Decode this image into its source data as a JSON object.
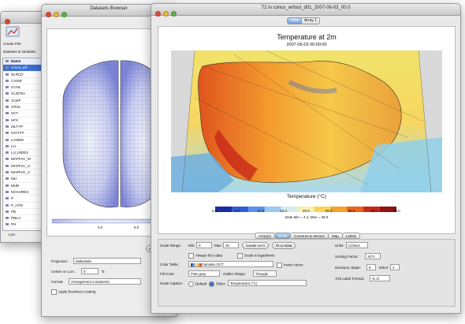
{
  "window_datasets": {
    "title": "",
    "toolbar_label": "Create Plot",
    "section_label": "Datasets & Variables",
    "column_name": "Name",
    "root_item": "conus_wrf",
    "items": [
      "NLRCD",
      "CANW",
      "CCNL",
      "CLDFRA",
      "CLWF",
      "CRGL",
      "HCT",
      "HFX",
      "ISLTYP",
      "IVGTYP",
      "LANDM",
      "LH",
      "LU_INDEX",
      "MAPFAC_M",
      "MAPFAC_U",
      "MAPFAC_V",
      "MU",
      "MUB",
      "NOAHRES",
      "P",
      "P_HYD",
      "PB",
      "PBLH",
      "PH"
    ],
    "lon_label": "Lon:"
  },
  "window_browser": {
    "title": "Datasets Browser",
    "colorbar_min": "0.0",
    "colorbar_max": "5.0",
    "projection_label": "Projection:",
    "projection_value": "Mollweide",
    "center_lon_label": "Center on Lon.:",
    "center_lon_value": "0",
    "center_lon_unit": "°E",
    "format_label": "Format:",
    "format_value": "Arrangement Continents",
    "bromley_label": "Apply Bromley's scaling",
    "arrays_btn": "Arrays"
  },
  "window_plot": {
    "title": "T2 in conus_wrfout_d01_2007-06-03_00.0",
    "top_tabs": [
      "Plot",
      "Array 1"
    ],
    "plot_title": "Temperature at 2m",
    "plot_subtitle": "2007-06-03 00:00:00",
    "colorbar_label": "Temperature (°C)",
    "colorbar_ticks": [
      "0.0",
      "5.0",
      "10.0",
      "15.0",
      "20.0",
      "25.0",
      "30.0",
      "35.0",
      "40.0"
    ],
    "data_range": "Data Min = 3.4, Max = 39.9",
    "bottom_tabs": [
      "Array(s)",
      "Scale",
      "Contours & Vectors",
      "Map",
      "Labels"
    ],
    "scale_range_label": "Scale Range:",
    "min_label": "Min:",
    "min_value": "0",
    "max_label": "Max:",
    "max_value": "40",
    "center_btn": "Center on 0",
    "fit_btn": "Fit to Data",
    "always_fit": "Always fit to data",
    "log_scale": "Scale is logarithmic",
    "color_table_label": "Color Table:",
    "color_table_value": "bamako GCT",
    "invert_colors": "Invert colors",
    "fill_color_label": "Fill Color:",
    "fill_color_value": "Pale gray",
    "outlier_label": "Outlier Shape:",
    "outlier_value": "Triangle",
    "scale_caption_label": "Scale Caption:",
    "caption_default": "Default",
    "caption_other": "Other:",
    "caption_value": "Temperature (°C)",
    "units_label": "Units:",
    "units_value": "Celsius",
    "scaling_factor_label": "Scaling Factor:",
    "scaling_factor_value": "10^",
    "scaling_factor_exp": "0",
    "divisions_label": "Divisions, Major:",
    "divisions_major": "8",
    "minor_label": "Minor:",
    "divisions_minor": "2",
    "tick_format_label": "Tick Label Format:",
    "tick_format_value": "%.1f"
  },
  "colors": {
    "colorbar": [
      "#1b2d9e",
      "#2f5cd0",
      "#5a94e8",
      "#9cc7ef",
      "#d6ebf0",
      "#f7f0b0",
      "#f9d457",
      "#f5a12c",
      "#e8631c",
      "#c7281a",
      "#8e1313"
    ]
  }
}
